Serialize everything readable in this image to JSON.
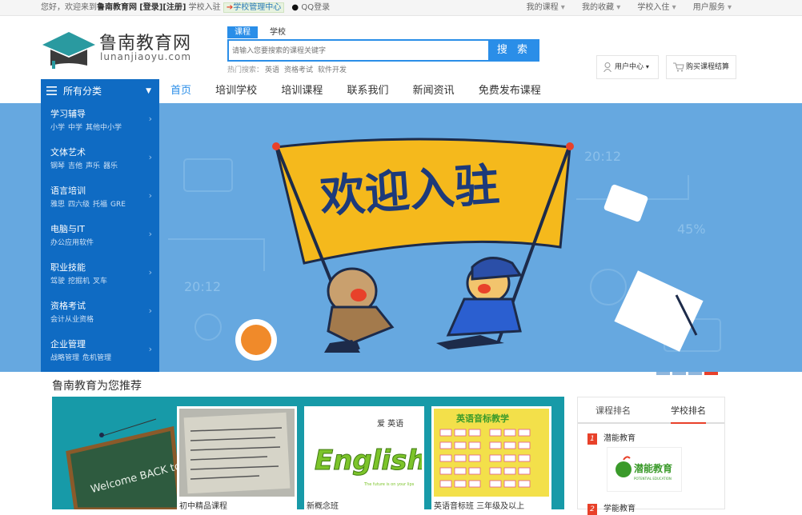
{
  "topbar": {
    "greeting": "您好，欢迎来到",
    "site": "鲁南教育网",
    "login": "[登录]",
    "register": "[注册]",
    "school_join": "学校入驻",
    "school_admin": "学校管理中心",
    "qq_login": "QQ登录",
    "right_links": [
      "我的课程",
      "我的收藏",
      "学校入住",
      "用户服务"
    ]
  },
  "logo": {
    "cn": "鲁南教育网",
    "en": "lunanjiaoyu.com"
  },
  "search": {
    "tabs": [
      "课程",
      "学校"
    ],
    "placeholder": "请输入您要搜索的课程关键字",
    "button": "搜 索",
    "hot_label": "热门搜索：",
    "hot_items": [
      "英语",
      "资格考试",
      "软件开发"
    ]
  },
  "user": {
    "center": "用户中心",
    "cart": "购买课程结算"
  },
  "nav": {
    "all_categories": "所有分类",
    "links": [
      "首页",
      "培训学校",
      "培训课程",
      "联系我们",
      "新闻资讯",
      "免费发布课程"
    ]
  },
  "categories": [
    {
      "title": "学习辅导",
      "subs": [
        "小学",
        "中学",
        "其他中小学"
      ]
    },
    {
      "title": "文体艺术",
      "subs": [
        "钢琴",
        "吉他",
        "声乐",
        "器乐"
      ]
    },
    {
      "title": "语言培训",
      "subs": [
        "雅思",
        "四六级",
        "托福",
        "GRE"
      ]
    },
    {
      "title": "电脑与IT",
      "subs": [
        "办公应用软件"
      ]
    },
    {
      "title": "职业技能",
      "subs": [
        "驾驶",
        "挖掘机",
        "叉车"
      ]
    },
    {
      "title": "资格考试",
      "subs": [
        "会计从业资格"
      ]
    },
    {
      "title": "企业管理",
      "subs": [
        "战略管理",
        "危机管理"
      ]
    }
  ],
  "banner": {
    "headline": "欢迎入驻",
    "clock": "20:12",
    "percent": "45%"
  },
  "recommend": {
    "title": "鲁南教育为您推荐",
    "chalk_text": "Welcome BACK to",
    "cards": [
      {
        "caption": "初中精品课程"
      },
      {
        "caption": "新概念班"
      },
      {
        "caption": "英语音标班 三年级及以上"
      }
    ],
    "card_texts": {
      "english_brand": "English",
      "english_tag": "The future is on your lips",
      "english_top": "爱 英语",
      "phonetic_title": "英语音标教学"
    }
  },
  "ranking": {
    "tabs": [
      "课程排名",
      "学校排名"
    ],
    "items": [
      {
        "num": "1",
        "name": "潜能教育"
      },
      {
        "num": "2",
        "name": "学能教育"
      }
    ],
    "logo_text": "潜能教育",
    "logo_sub": "POTENTIAL EDUCATION"
  },
  "colors": {
    "brand_blue": "#0f6bc3",
    "accent": "#2a8ee8",
    "banner_bg": "#66a8e0",
    "red": "#e8412a"
  }
}
